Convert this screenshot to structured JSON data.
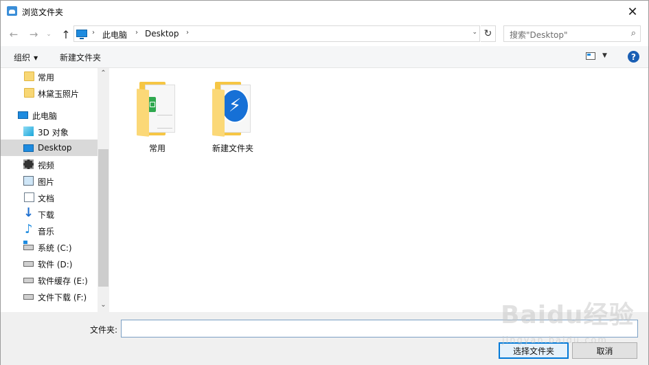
{
  "window": {
    "title": "浏览文件夹",
    "close_glyph": "✕"
  },
  "address": {
    "back_glyph": "←",
    "forward_glyph": "→",
    "recent_glyph": "⌄",
    "up_glyph": "↑",
    "crumbs": [
      "此电脑",
      "Desktop"
    ],
    "sep_glyph": "›",
    "drop_glyph": "⌄",
    "refresh_glyph": "↻"
  },
  "search": {
    "placeholder": "搜索\"Desktop\"",
    "icon": "search-icon",
    "glyph": "⌕"
  },
  "toolbar": {
    "organize_label": "组织",
    "organize_caret": "▼",
    "new_folder_label": "新建文件夹",
    "view_caret": "▼",
    "help_glyph": "?"
  },
  "nav": {
    "up_glyph": "⌃",
    "down_glyph": "⌄",
    "items": [
      {
        "label": "常用",
        "icon": "folder-icon"
      },
      {
        "label": "林黛玉照片",
        "icon": "folder-icon"
      },
      {
        "label": "此电脑",
        "icon": "computer-icon"
      },
      {
        "label": "3D 对象",
        "icon": "3d-objects-icon"
      },
      {
        "label": "Desktop",
        "icon": "desktop-icon",
        "selected": true
      },
      {
        "label": "视频",
        "icon": "video-icon"
      },
      {
        "label": "图片",
        "icon": "pictures-icon"
      },
      {
        "label": "文档",
        "icon": "documents-icon"
      },
      {
        "label": "下载",
        "icon": "downloads-icon"
      },
      {
        "label": "音乐",
        "icon": "music-icon"
      },
      {
        "label": "系统 (C:)",
        "icon": "drive-c-icon"
      },
      {
        "label": "软件 (D:)",
        "icon": "drive-icon"
      },
      {
        "label": "软件缓存 (E:)",
        "icon": "drive-icon"
      },
      {
        "label": "文件下载 (F:)",
        "icon": "drive-icon"
      }
    ]
  },
  "content": {
    "items": [
      {
        "label": "常用",
        "icon": "folder-excel-icon"
      },
      {
        "label": "新建文件夹",
        "icon": "folder-app-icon",
        "badge_glyph": "⚡"
      }
    ]
  },
  "footer": {
    "folder_label": "文件夹:",
    "folder_value": "",
    "ok_label": "选择文件夹",
    "cancel_label": "取消"
  },
  "watermark": {
    "text": "Baidu经验",
    "sub": "jingyan.baidu.com"
  },
  "colors": {
    "accent": "#0078d7",
    "selected_bg": "#d9d9d9",
    "folder": "#f6c644"
  }
}
